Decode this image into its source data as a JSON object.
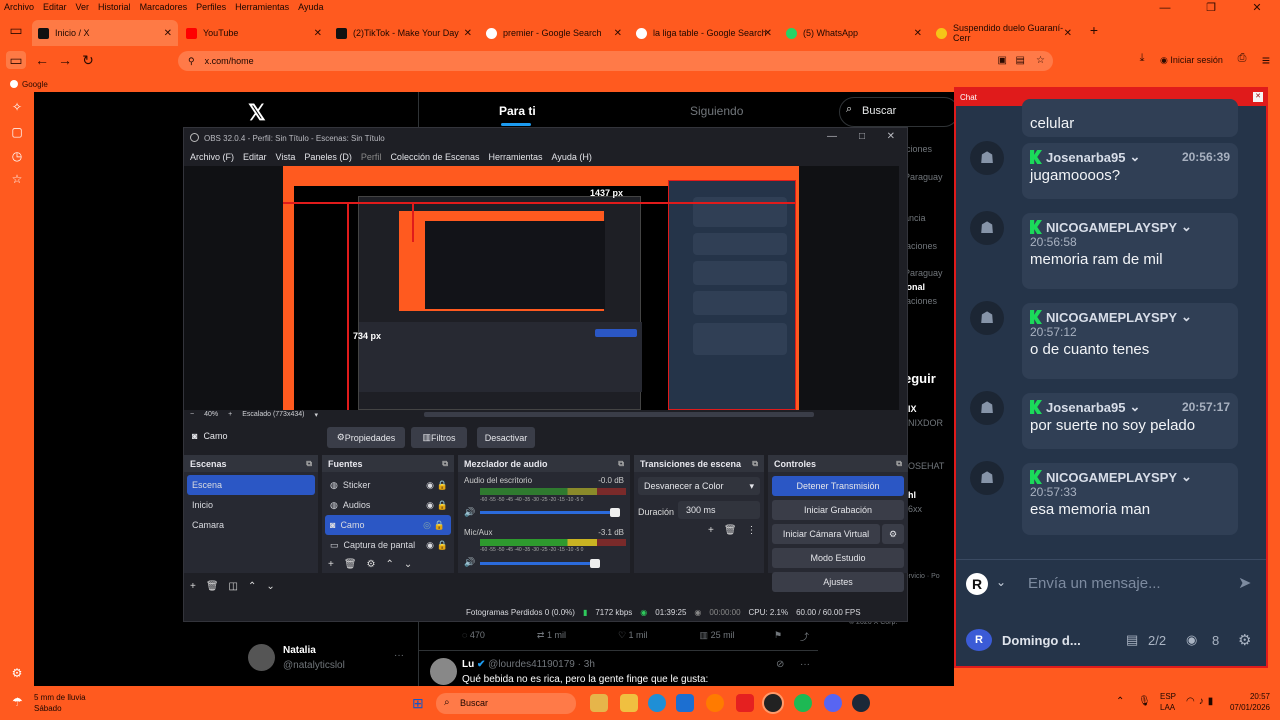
{
  "browser_menu": [
    "Archivo",
    "Editar",
    "Ver",
    "Historial",
    "Marcadores",
    "Perfiles",
    "Herramientas",
    "Ayuda"
  ],
  "tabs": [
    {
      "label": "Inicio / X",
      "color": "#111111"
    },
    {
      "label": "YouTube",
      "color": "#ff0000"
    },
    {
      "label": "(2)TikTok - Make Your Day",
      "color": "#111111"
    },
    {
      "label": "premier - Google Search",
      "color": "#4285f4"
    },
    {
      "label": "la liga table - Google Search",
      "color": "#4285f4"
    },
    {
      "label": "(5) WhatsApp",
      "color": "#25d366"
    },
    {
      "label": "Suspendido duelo Guaraní-Cerr",
      "color": "#f5c518"
    }
  ],
  "url": "x.com/home",
  "signin": "Iniciar sesión",
  "bookmark": "Google",
  "x": {
    "tab_for_you": "Para ti",
    "tab_following": "Siguiendo",
    "search_placeholder": "Buscar",
    "right_items": [
      "iciones",
      "Paraguay",
      "ancia",
      "laciones",
      "Paraguay",
      "ional",
      "laciones"
    ],
    "follow": "eguir",
    "follow2": "eguir",
    "who": [
      "IX",
      "NIXDOR",
      "OSEHAT",
      "hl",
      "6xx"
    ],
    "footer": "Servicio  ·  Po",
    "footer2": "© 2026 X Corp.",
    "stats": {
      "replies": "470",
      "retweets": "1 mil",
      "likes": "1 mil",
      "views": "25 mil"
    },
    "user1": {
      "name": "Natalia",
      "handle": "@natalyticslol"
    },
    "tweet": {
      "name": "Lu",
      "handle": "@lourdes41190179 · 3h",
      "text": "Qué bebida no es rica, pero la gente finge que le gusta:"
    }
  },
  "obs": {
    "title": "OBS 32.0.4 - Perfil: Sin Título - Escenas: Sin Título",
    "menu": [
      "Archivo (F)",
      "Editar",
      "Vista",
      "Paneles (D)",
      "Perfil",
      "Colección de Escenas",
      "Herramientas",
      "Ayuda (H)"
    ],
    "zoom": "40%",
    "scaled": "Escalado (773x434)",
    "px_w": "1437 px",
    "px_h": "734 px",
    "source_name": "Camo",
    "btn_props": "Propiedades",
    "btn_filters": "Filtros",
    "btn_deactivate": "Desactivar",
    "scenes_title": "Escenas",
    "scenes": [
      "Escena",
      "Inicio",
      "Camara"
    ],
    "sources_title": "Fuentes",
    "sources": [
      "Sticker",
      "Audios",
      "Camo",
      "Captura de pantal"
    ],
    "mixer_title": "Mezclador de audio",
    "mixer": [
      {
        "name": "Audio del escritorio",
        "db": "-0.0 dB"
      },
      {
        "name": "Mic/Aux",
        "db": "-3.1 dB"
      }
    ],
    "meter_scale": "-60 -55 -50 -45 -40 -35 -30 -25 -20 -15 -10 -5 0",
    "transitions_title": "Transiciones de escena",
    "transition": "Desvanecer a Color",
    "duration_label": "Duración",
    "duration": "300 ms",
    "controls_title": "Controles",
    "controls": [
      "Detener Transmisión",
      "Iniciar Grabación",
      "Iniciar Cámara Virtual",
      "Modo Estudio",
      "Ajustes"
    ],
    "status": {
      "dropped": "Fotogramas Perdidos 0 (0.0%)",
      "kbps": "7172 kbps",
      "live": "01:39:25",
      "rec": "00:00:00",
      "cpu": "CPU: 2.1%",
      "fps": "60.00 / 60.00 FPS"
    }
  },
  "chat": {
    "title": "Chat",
    "top_text": "celular",
    "messages": [
      {
        "user": "Josenarba95",
        "time": "20:56:39",
        "text": "jugamoooos?"
      },
      {
        "user": "NICOGAMEPLAYSPY",
        "time": "20:56:58",
        "text": "memoria ram de mil"
      },
      {
        "user": "NICOGAMEPLAYSPY",
        "time": "20:57:12",
        "text": "o de cuanto tenes"
      },
      {
        "user": "Josenarba95",
        "time": "20:57:17",
        "text": "por suerte no soy pelado"
      },
      {
        "user": "NICOGAMEPLAYSPY",
        "time": "20:57:33",
        "text": "esa memoria man"
      }
    ],
    "input_placeholder": "Envía un mensaje...",
    "channel": "Domingo d...",
    "ratio": "2/2",
    "viewers": "8",
    "kick_color": "#1bd95a"
  },
  "taskbar": {
    "weather": "5 mm de lluvia",
    "day": "Sábado",
    "search": "Buscar",
    "lang": "ESP",
    "lang2": "LAA",
    "time": "20:57",
    "date": "07/01/2026"
  }
}
